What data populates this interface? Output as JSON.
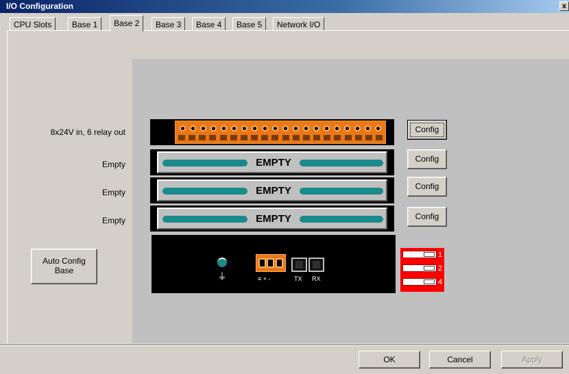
{
  "window": {
    "title": "I/O Configuration",
    "close_glyph": "x"
  },
  "tabs": [
    {
      "label": "CPU Slots",
      "active": false
    },
    {
      "label": "Base 1",
      "active": false
    },
    {
      "label": "Base 2",
      "active": true
    },
    {
      "label": "Base 3",
      "active": false
    },
    {
      "label": "Base 4",
      "active": false
    },
    {
      "label": "Base 5",
      "active": false
    },
    {
      "label": "Network I/O",
      "active": false
    }
  ],
  "slots": [
    {
      "label": "8x24V in, 6 relay out",
      "module": "terminal-block",
      "config_label": "Config"
    },
    {
      "label": "Empty",
      "module": "empty",
      "card_text": "EMPTY",
      "config_label": "Config"
    },
    {
      "label": "Empty",
      "module": "empty",
      "card_text": "EMPTY",
      "config_label": "Config"
    },
    {
      "label": "Empty",
      "module": "empty",
      "card_text": "EMPTY",
      "config_label": "Config"
    }
  ],
  "auto_config": {
    "line1": "Auto Config",
    "line2": "Base"
  },
  "base_unit": {
    "power_labels": "≡ + -",
    "tx_label": "TX",
    "rx_label": "RX",
    "dip_switch_numbers": [
      "1",
      "2",
      "4"
    ]
  },
  "dialog_buttons": {
    "ok": "OK",
    "cancel": "Cancel",
    "apply": "Apply"
  },
  "colors": {
    "terminal_orange": "#e87818",
    "empty_bar_teal": "#1a8a8a",
    "dip_red": "#ff0000",
    "title_bar": "#0a246a"
  }
}
